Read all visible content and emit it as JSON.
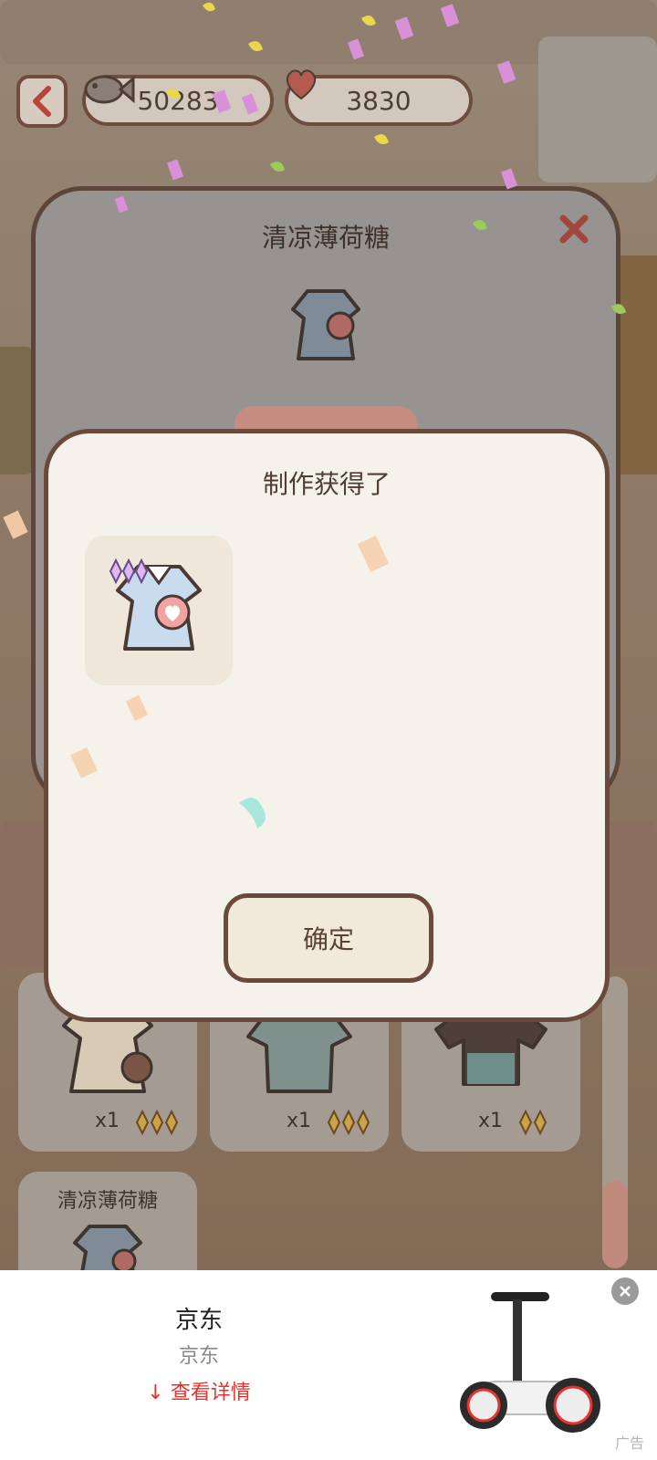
{
  "currency": {
    "fish_amount": "50283",
    "heart_amount": "3830"
  },
  "back_panel": {
    "title": "清凉薄荷糖"
  },
  "dialog": {
    "title": "制作获得了",
    "confirm_label": "确定"
  },
  "grid": {
    "items": [
      {
        "count": "x1"
      },
      {
        "count": "x1"
      },
      {
        "count": "x1"
      }
    ],
    "partial_item_label": "清凉薄荷糖"
  },
  "ad": {
    "title": "京东",
    "subtitle": "京东",
    "link": "查看详情",
    "tag": "广告"
  },
  "colors": {
    "panel_border": "#6b4a3c",
    "dialog_bg": "#f5f2ec",
    "ad_link": "#e5322d"
  }
}
